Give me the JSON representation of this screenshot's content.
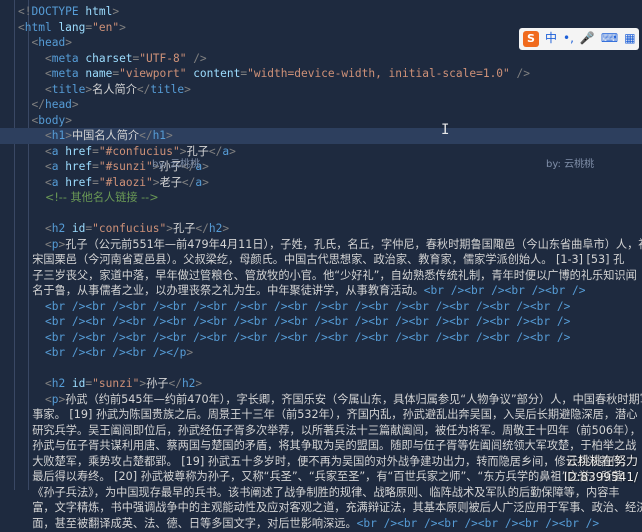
{
  "watermark": {
    "left": "by: 云桃桃",
    "right": "by: 云桃桃"
  },
  "ime": {
    "label": "中",
    "icons": [
      "dot-icon",
      "comma-icon",
      "mic-icon",
      "keyboard-icon",
      "grid-icon"
    ]
  },
  "corner": {
    "line1": "云桃桃在努力",
    "line2": "ID:8399541/"
  },
  "lines": [
    [
      [
        "pun",
        "<!"
      ],
      [
        "tag",
        "DOCTYPE"
      ],
      [
        "attr",
        " html"
      ],
      [
        "pun",
        ">"
      ]
    ],
    [
      [
        "pun",
        "<"
      ],
      [
        "tag",
        "html"
      ],
      [
        "attr",
        " lang"
      ],
      [
        "pun",
        "="
      ],
      [
        "str",
        "\"en\""
      ],
      [
        "pun",
        ">"
      ]
    ],
    [
      [
        "txt",
        "  "
      ],
      [
        "pun",
        "<"
      ],
      [
        "tag",
        "head"
      ],
      [
        "pun",
        ">"
      ]
    ],
    [
      [
        "txt",
        "    "
      ],
      [
        "pun",
        "<"
      ],
      [
        "tag",
        "meta"
      ],
      [
        "attr",
        " charset"
      ],
      [
        "pun",
        "="
      ],
      [
        "str",
        "\"UTF-8\""
      ],
      [
        "pun",
        " />"
      ]
    ],
    [
      [
        "txt",
        "    "
      ],
      [
        "pun",
        "<"
      ],
      [
        "tag",
        "meta"
      ],
      [
        "attr",
        " name"
      ],
      [
        "pun",
        "="
      ],
      [
        "str",
        "\"viewport\""
      ],
      [
        "attr",
        " content"
      ],
      [
        "pun",
        "="
      ],
      [
        "str",
        "\"width=device-width, initial-scale=1.0\""
      ],
      [
        "pun",
        " />"
      ]
    ],
    [
      [
        "txt",
        "    "
      ],
      [
        "pun",
        "<"
      ],
      [
        "tag",
        "title"
      ],
      [
        "pun",
        ">"
      ],
      [
        "txt",
        "名人简介"
      ],
      [
        "pun",
        "</"
      ],
      [
        "tag",
        "title"
      ],
      [
        "pun",
        ">"
      ]
    ],
    [
      [
        "txt",
        "  "
      ],
      [
        "pun",
        "</"
      ],
      [
        "tag",
        "head"
      ],
      [
        "pun",
        ">"
      ]
    ],
    [
      [
        "txt",
        "  "
      ],
      [
        "pun",
        "<"
      ],
      [
        "tag",
        "body"
      ],
      [
        "pun",
        ">"
      ]
    ],
    [
      [
        "txt",
        "    "
      ],
      [
        "pun",
        "<"
      ],
      [
        "tag",
        "h1"
      ],
      [
        "pun",
        ">"
      ],
      [
        "txt",
        "中国名人简介"
      ],
      [
        "pun",
        "</"
      ],
      [
        "tag",
        "h1"
      ],
      [
        "pun",
        ">"
      ]
    ],
    [
      [
        "txt",
        "    "
      ],
      [
        "pun",
        "<"
      ],
      [
        "tag",
        "a"
      ],
      [
        "attr",
        " href"
      ],
      [
        "pun",
        "="
      ],
      [
        "str",
        "\"#confucius\""
      ],
      [
        "pun",
        ">"
      ],
      [
        "txt",
        "孔子"
      ],
      [
        "pun",
        "</"
      ],
      [
        "tag",
        "a"
      ],
      [
        "pun",
        ">"
      ]
    ],
    [
      [
        "txt",
        "    "
      ],
      [
        "pun",
        "<"
      ],
      [
        "tag",
        "a"
      ],
      [
        "attr",
        " href"
      ],
      [
        "pun",
        "="
      ],
      [
        "str",
        "\"#sunzi\""
      ],
      [
        "pun",
        ">"
      ],
      [
        "txt",
        "孙子"
      ],
      [
        "pun",
        "</"
      ],
      [
        "tag",
        "a"
      ],
      [
        "pun",
        ">"
      ]
    ],
    [
      [
        "txt",
        "    "
      ],
      [
        "pun",
        "<"
      ],
      [
        "tag",
        "a"
      ],
      [
        "attr",
        " href"
      ],
      [
        "pun",
        "="
      ],
      [
        "str",
        "\"#laozi\""
      ],
      [
        "pun",
        ">"
      ],
      [
        "txt",
        "老子"
      ],
      [
        "pun",
        "</"
      ],
      [
        "tag",
        "a"
      ],
      [
        "pun",
        ">"
      ]
    ],
    [
      [
        "txt",
        "    "
      ],
      [
        "cmt",
        "<!-- 其他名人链接 -->"
      ]
    ],
    [
      [
        "txt",
        ""
      ]
    ],
    [
      [
        "txt",
        "    "
      ],
      [
        "pun",
        "<"
      ],
      [
        "tag",
        "h2"
      ],
      [
        "attr",
        " id"
      ],
      [
        "pun",
        "="
      ],
      [
        "str",
        "\"confucius\""
      ],
      [
        "pun",
        ">"
      ],
      [
        "txt",
        "孔子"
      ],
      [
        "pun",
        "</"
      ],
      [
        "tag",
        "h2"
      ],
      [
        "pun",
        ">"
      ]
    ],
    [
      [
        "txt",
        "    "
      ],
      [
        "pun",
        "<"
      ],
      [
        "tag",
        "p"
      ],
      [
        "pun",
        ">"
      ],
      [
        "txt",
        "孔子（公元前551年—前479年4月11日），子姓，孔氏，名丘，字仲尼，春秋时期鲁国陬邑（今山东省曲阜市）人，祖籍"
      ]
    ],
    [
      [
        "txt",
        "    宋国栗邑（今河南省夏邑县）。父叔梁纥，母颜氏。中国古代思想家、政治家、教育家，儒家学派创始人。 [1-3] [53] 孔"
      ]
    ],
    [
      [
        "txt",
        "    子三岁丧父，家道中落，早年做过管粮仓、管放牧的小官。他“少好礼”，自幼熟悉传统礼制，青年时便以广博的礼乐知识闻"
      ]
    ],
    [
      [
        "txt",
        "    名于鲁，从事儒者之业，以办理丧祭之礼为生。中年聚徒讲学，从事教育活动。"
      ],
      [
        "ent",
        "<br /><br /><br /><br />"
      ]
    ],
    [
      [
        "txt",
        "    "
      ],
      [
        "ent",
        "<br /><br /><br /><br /><br /><br /><br /><br /><br /><br /><br /><br /><br />"
      ]
    ],
    [
      [
        "txt",
        "    "
      ],
      [
        "ent",
        "<br /><br /><br /><br /><br /><br /><br /><br /><br /><br /><br /><br /><br />"
      ]
    ],
    [
      [
        "txt",
        "    "
      ],
      [
        "ent",
        "<br /><br /><br /><br /><br /><br /><br /><br /><br /><br /><br /><br /><br />"
      ]
    ],
    [
      [
        "txt",
        "    "
      ],
      [
        "ent",
        "<br /><br /><br /></"
      ],
      [
        "tag",
        "p"
      ],
      [
        "pun",
        ">"
      ]
    ],
    [
      [
        "txt",
        ""
      ]
    ],
    [
      [
        "txt",
        "    "
      ],
      [
        "pun",
        "<"
      ],
      [
        "tag",
        "h2"
      ],
      [
        "attr",
        " id"
      ],
      [
        "pun",
        "="
      ],
      [
        "str",
        "\"sunzi\""
      ],
      [
        "pun",
        ">"
      ],
      [
        "txt",
        "孙子"
      ],
      [
        "pun",
        "</"
      ],
      [
        "tag",
        "h2"
      ],
      [
        "pun",
        ">"
      ]
    ],
    [
      [
        "txt",
        "    "
      ],
      [
        "pun",
        "<"
      ],
      [
        "tag",
        "p"
      ],
      [
        "pun",
        ">"
      ],
      [
        "txt",
        "孙武（约前545年—约前470年），字长卿，齐国乐安（今属山东，具体归属参见“人物争议”部分）人，中国春秋时期军"
      ]
    ],
    [
      [
        "txt",
        "    事家。 [19] 孙武为陈国贵族之后。周景王十三年（前532年），齐国内乱，孙武避乱出奔吴国，入吴后长期避隐深居，潜心"
      ]
    ],
    [
      [
        "txt",
        "    研究兵学。吴王阖闾即位后，孙武经伍子胥多次举荐，以所著兵法十三篇献阖闾，被任为将军。周敬王十四年（前506年），"
      ]
    ],
    [
      [
        "txt",
        "    孙武与伍子胥共谋利用唐、蔡两国与楚国的矛盾，将其争取为吴的盟国。随即与伍子胥等佐阖闾统领大军攻楚，于柏举之战"
      ]
    ],
    [
      [
        "txt",
        "    大败楚军，乘势攻占楚都郢。 [19] 孙武五十多岁时，便不再为吴国的对外战争建功出力，转而隐居乡间，修订兵法著作，"
      ]
    ],
    [
      [
        "txt",
        "    最后得以寿终。 [20] 孙武被尊称为孙子，又称“兵圣”、“兵家至圣”，有“百世兵家之师”、“东方兵学的鼻祖”之誉。所著"
      ]
    ],
    [
      [
        "txt",
        "    《孙子兵法》，为中国现存最早的兵书。该书阐述了战争制胜的规律、战略原则、临阵战术及军队的后勤保障等，内容丰"
      ]
    ],
    [
      [
        "txt",
        "    富，文字精炼，书中强调战争中的主观能动性及应对客观之道，充满辩证法，其基本原则被后人广泛应用于军事、政治、经济等领"
      ]
    ],
    [
      [
        "txt",
        "    面，甚至被翻译成英、法、德、日等多国文字，对后世影响深远。"
      ],
      [
        "ent",
        "<br /><br /><br /><br /><br /><br />"
      ]
    ]
  ]
}
